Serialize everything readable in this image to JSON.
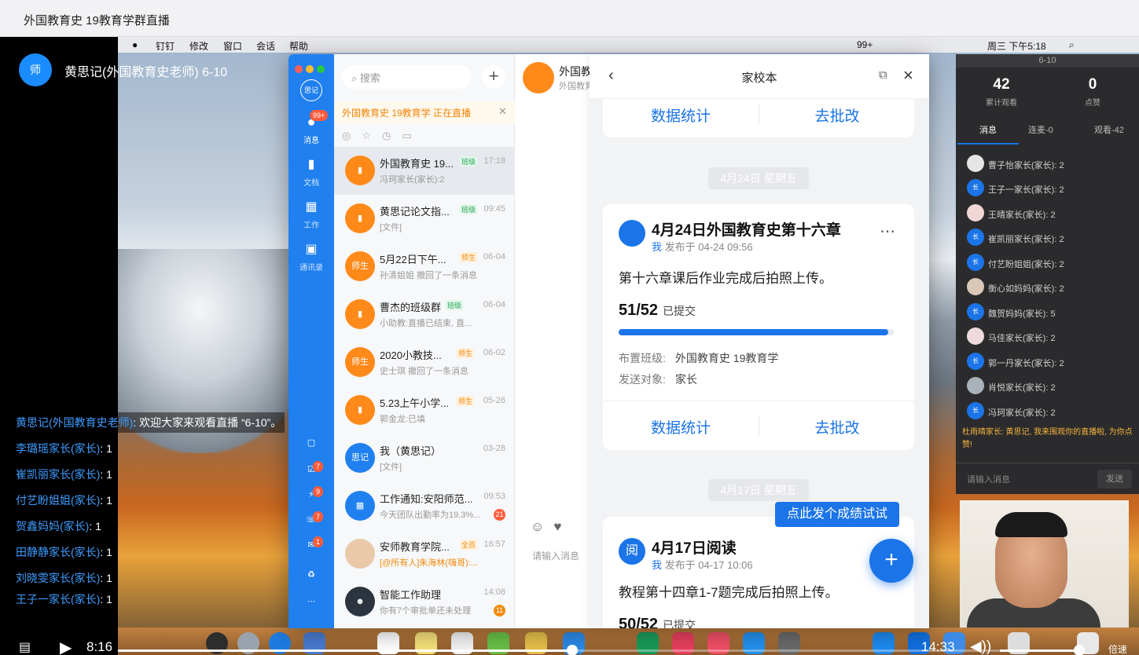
{
  "title": "外国教育史 19教育学群直播",
  "host": {
    "avatar": "师",
    "name": "黄思记(外国教育史老师) 6-10"
  },
  "menubar": {
    "items": [
      "钉钉",
      "修改",
      "窗口",
      "会话",
      "帮助"
    ],
    "status": "99+",
    "clock": "周三 下午5:18"
  },
  "sidebar": {
    "avatar": "思记",
    "items": [
      {
        "label": "消息",
        "badge": "99+"
      },
      {
        "label": "文档"
      },
      {
        "label": "工作"
      },
      {
        "label": "通讯录"
      }
    ],
    "badges": [
      "7",
      "9",
      "7",
      "1"
    ]
  },
  "list": {
    "search_placeholder": "搜索",
    "add": "+",
    "notice": "外国教育史 19教育学 正在直播",
    "notice_close": "✕",
    "items": [
      {
        "title": "外国教育史 19...",
        "tag": "班级",
        "time": "17:18",
        "preview": "冯珂家长(家长):2",
        "avatar": "",
        "badge": ""
      },
      {
        "title": "黄思记论文指...",
        "tag": "班级",
        "time": "09:45",
        "preview": "[文件]",
        "avatar": "",
        "badge": ""
      },
      {
        "title": "5月22日下午...",
        "tag": "师生",
        "time": "06-04",
        "preview": "孙清姐姐 撤回了一条消息",
        "avatar": "师生",
        "badge": ""
      },
      {
        "title": "曹杰的班级群",
        "tag": "班级",
        "time": "06-04",
        "preview": "小助教:直播已结束, 直...",
        "avatar": "",
        "badge": ""
      },
      {
        "title": "2020小教技...",
        "tag": "师生",
        "time": "06-02",
        "preview": "史士琪 撤回了一条消息",
        "avatar": "师生",
        "badge": ""
      },
      {
        "title": "5.23上午小学...",
        "tag": "师生",
        "time": "05-26",
        "preview": "郭金龙:已填",
        "avatar": "",
        "badge": ""
      },
      {
        "title": "我（黄思记）",
        "tag": "",
        "time": "03-28",
        "preview": "[文件]",
        "avatar": "思记",
        "badge": ""
      },
      {
        "title": "工作通知:安阳师范...",
        "tag": "",
        "time": "09:53",
        "preview": "今天团队出勤率为19.3%...",
        "avatar": "",
        "badge": "21"
      },
      {
        "title": "安师教育学院...",
        "tag": "全员",
        "time": "16:57",
        "preview": "[@所有人]朱海林(嗨哥):...",
        "avatar": "",
        "badge": ""
      },
      {
        "title": "智能工作助理",
        "tag": "",
        "time": "14:08",
        "preview": "你有7个审批单还未处理",
        "avatar": "",
        "badge": "11"
      }
    ]
  },
  "chat": {
    "title": "外国教",
    "subtitle": "外国教育",
    "input_placeholder": "请输入消息"
  },
  "panel": {
    "title": "家校本",
    "btn_stats": "数据统计",
    "btn_review": "去批改",
    "date1": "4月24日 星期五",
    "card1": {
      "icon": "",
      "title": "4月24日外国教育史第十六章",
      "me": "我",
      "meta": "发布于 04-24 09:56",
      "desc": "第十六章课后作业完成后拍照上传。",
      "count": "51/52",
      "count_label": "已提交",
      "progress": 0.98,
      "class_label": "布置班级:",
      "class_value": "外国教育史 19教育学",
      "target_label": "发送对象:",
      "target_value": "家长"
    },
    "date2": "4月17日 星期五",
    "card2": {
      "icon": "阅",
      "title": "4月17日阅读",
      "me": "我",
      "meta": "发布于 04-17 10:06",
      "desc": "教程第十四章1-7题完成后拍照上传。",
      "count": "50/52",
      "count_label": "已提交"
    },
    "tip": "点此发个成绩试试"
  },
  "live": {
    "window_title": "6-10",
    "stats": [
      {
        "value": "42",
        "label": "累计观看"
      },
      {
        "value": "0",
        "label": "点赞"
      }
    ],
    "tabs": [
      "消息",
      "连麦-0",
      "观看-42"
    ],
    "messages": [
      {
        "av": "",
        "text": "曹子怡家长(家长): 2"
      },
      {
        "av": "长",
        "text": "王子一家长(家长): 2"
      },
      {
        "av": "",
        "text": "王晴家长(家长): 2"
      },
      {
        "av": "长",
        "text": "崔凯丽家长(家长): 2"
      },
      {
        "av": "长",
        "text": "付艺盼姐姐(家长): 2"
      },
      {
        "av": "",
        "text": "衡心如妈妈(家长): 2"
      },
      {
        "av": "长",
        "text": "魏贺妈妈(家长): 5"
      },
      {
        "av": "",
        "text": "马佳家长(家长): 2"
      },
      {
        "av": "长",
        "text": "郭一丹家长(家长): 2"
      },
      {
        "av": "",
        "text": "肖悦家长(家长): 2"
      },
      {
        "av": "长",
        "text": "冯珂家长(家长): 2"
      }
    ],
    "highlight": "杜雨晴家长: 黄思记, 我来围观你的直播啦, 为你点赞!",
    "input_placeholder": "请输入消息",
    "send": "发送"
  },
  "comments": [
    {
      "name": "黄思记(外国教育史老师)",
      "text": ": 欢迎大家来观看直播 “6-10”。"
    },
    {
      "name": "李璐瑶家长(家长)",
      "text": ": 1"
    },
    {
      "name": "崔凯丽家长(家长)",
      "text": ": 1"
    },
    {
      "name": "付艺盼姐姐(家长)",
      "text": ": 1"
    },
    {
      "name": "贺鑫妈妈(家长)",
      "text": ": 1"
    },
    {
      "name": "田静静家长(家长)",
      "text": ": 1"
    },
    {
      "name": "刘晓雯家长(家长)",
      "text": ": 1"
    },
    {
      "name": "王子一家长(家长)",
      "text": ": 1"
    }
  ],
  "player": {
    "current": "8:16",
    "duration": "14:33",
    "played": 0.47,
    "speed": "倍速"
  },
  "colors": {
    "accent": "#1b74e8",
    "dingtalk_sidebar": "#2080ef",
    "orange": "#ff8a1a"
  }
}
